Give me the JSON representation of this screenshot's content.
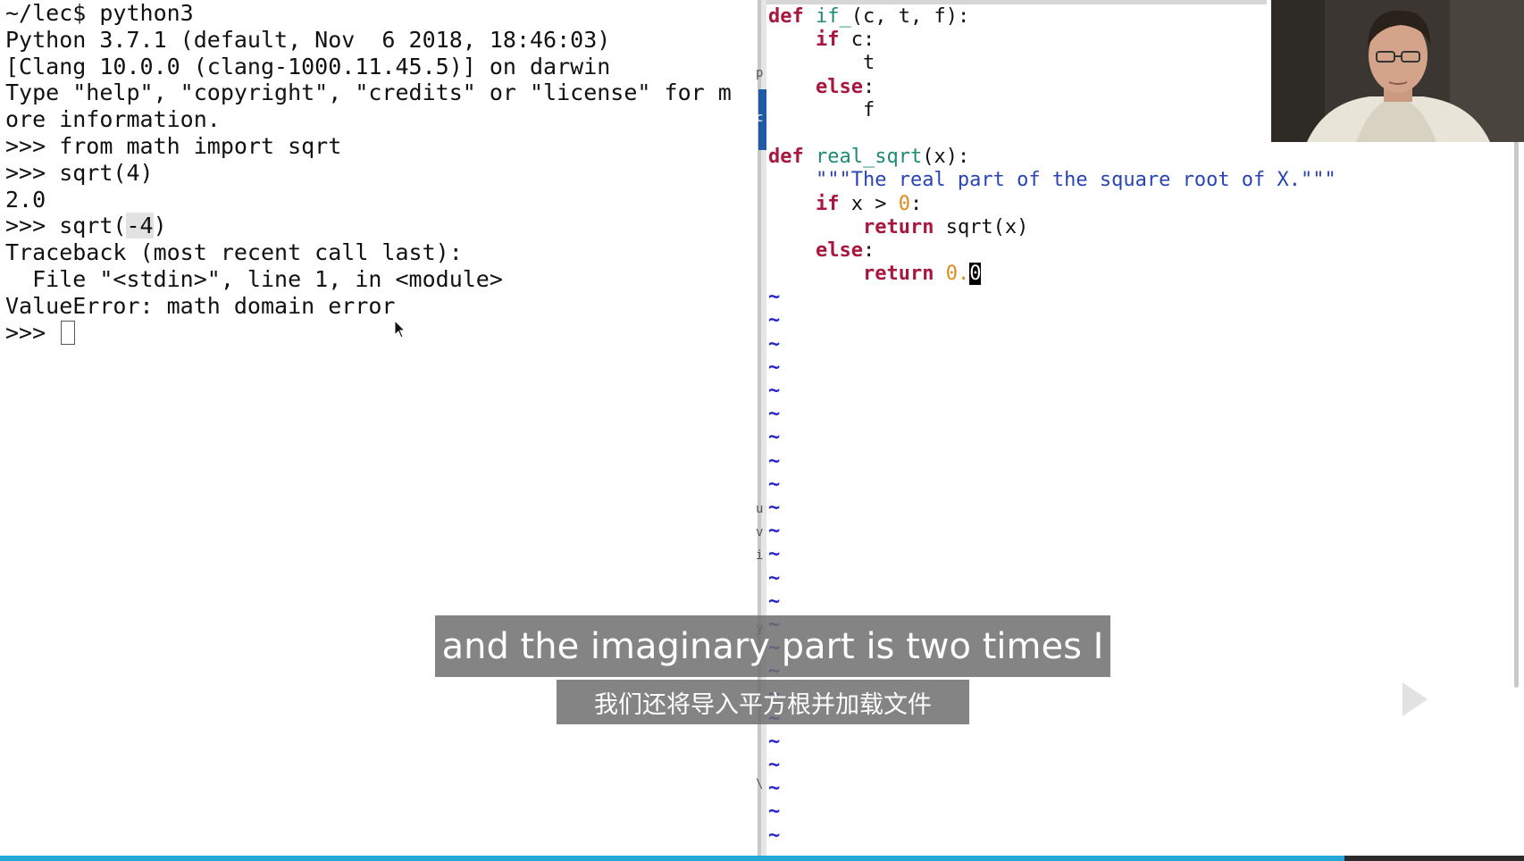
{
  "terminal": {
    "lines": [
      "~/lec$ python3",
      "Python 3.7.1 (default, Nov  6 2018, 18:46:03)",
      "[Clang 10.0.0 (clang-1000.11.45.5)] on darwin",
      "Type \"help\", \"copyright\", \"credits\" or \"license\" for m",
      "ore information.",
      ">>> from math import sqrt",
      ">>> sqrt(4)",
      "2.0"
    ],
    "line_sqrt_neg": {
      "prefix": ">>> sqrt(",
      "highlight": "-4",
      "suffix": ")"
    },
    "lines_after": [
      "Traceback (most recent call last):",
      "  File \"<stdin>\", line 1, in <module>",
      "ValueError: math domain error"
    ],
    "prompt": ">>> "
  },
  "editor": {
    "def_kw": "def",
    "if_kw": "if",
    "else_kw": "else",
    "return_kw": "return",
    "if_fn_name": "if_",
    "if_fn_params": "(c, t, f):",
    "if_cond": " c:",
    "colon": ":",
    "t_value": "t",
    "f_value": "f",
    "real_sqrt_name": "real_sqrt",
    "real_sqrt_params": "(x):",
    "docstring": "\"\"\"The real part of the square root of X.\"\"\"",
    "compare_prefix": " x > ",
    "zero": "0",
    "return_sqrt": " sqrt(x)",
    "return_zero_int": "0.",
    "return_zero_cursor": "0",
    "tilde": "~",
    "tilde_count": 24
  },
  "gutter_chars": [
    "p",
    "c",
    "u",
    "v",
    "i",
    "y",
    "\\"
  ],
  "subtitles": {
    "english": "and the imaginary part is two times I",
    "chinese": "我们还将导入平方根并加载文件"
  },
  "player": {
    "progress": 0.882
  },
  "colors": {
    "keyword": "#a8173d",
    "function_name": "#1e8a74",
    "string": "#2a44b4",
    "number": "#e08a1a",
    "tilde": "#2222cc",
    "progress": "#23a8d8"
  }
}
